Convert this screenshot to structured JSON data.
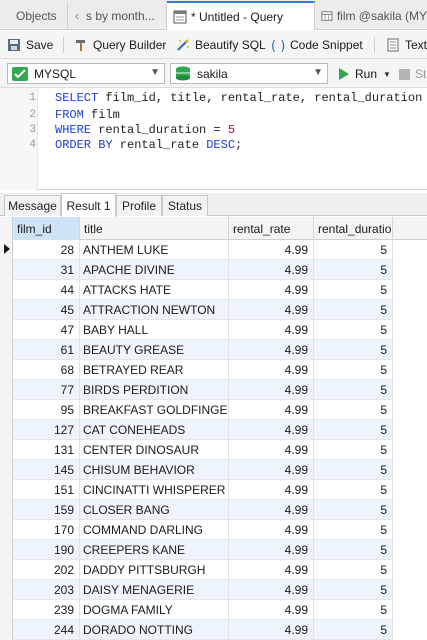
{
  "tabs": [
    {
      "label": "Objects"
    },
    {
      "label": "s by month..."
    },
    {
      "label": "* Untitled - Query"
    },
    {
      "label": "film @sakila (MY"
    }
  ],
  "toolbar": {
    "save": "Save",
    "query_builder": "Query Builder",
    "beautify": "Beautify SQL",
    "snippet": "Code Snippet",
    "text": "Text"
  },
  "connection": {
    "server": "MYSQL",
    "database": "sakila",
    "run": "Run",
    "stop": "St"
  },
  "editor": {
    "lines": [
      {
        "n": "1",
        "parts": [
          [
            "kw",
            "SELECT"
          ],
          [
            "t",
            " film_id, title, rental_rate, rental_duration"
          ]
        ]
      },
      {
        "n": "2",
        "parts": [
          [
            "kw",
            "FROM"
          ],
          [
            "t",
            " film"
          ]
        ]
      },
      {
        "n": "3",
        "parts": [
          [
            "kw",
            "WHERE"
          ],
          [
            "t",
            " rental_duration = "
          ],
          [
            "num",
            "5"
          ]
        ]
      },
      {
        "n": "4",
        "parts": [
          [
            "kw",
            "ORDER BY"
          ],
          [
            "t",
            " rental_rate "
          ],
          [
            "kw",
            "DESC"
          ],
          [
            "t",
            ";"
          ]
        ]
      }
    ]
  },
  "result_tabs": [
    "Message",
    "Result 1",
    "Profile",
    "Status"
  ],
  "grid": {
    "columns": [
      "film_id",
      "title",
      "rental_rate",
      "rental_duratio"
    ],
    "rows": [
      [
        "28",
        "ANTHEM LUKE",
        "4.99",
        "5"
      ],
      [
        "31",
        "APACHE DIVINE",
        "4.99",
        "5"
      ],
      [
        "44",
        "ATTACKS HATE",
        "4.99",
        "5"
      ],
      [
        "45",
        "ATTRACTION NEWTON",
        "4.99",
        "5"
      ],
      [
        "47",
        "BABY HALL",
        "4.99",
        "5"
      ],
      [
        "61",
        "BEAUTY GREASE",
        "4.99",
        "5"
      ],
      [
        "68",
        "BETRAYED REAR",
        "4.99",
        "5"
      ],
      [
        "77",
        "BIRDS PERDITION",
        "4.99",
        "5"
      ],
      [
        "95",
        "BREAKFAST GOLDFINGER",
        "4.99",
        "5"
      ],
      [
        "127",
        "CAT CONEHEADS",
        "4.99",
        "5"
      ],
      [
        "131",
        "CENTER DINOSAUR",
        "4.99",
        "5"
      ],
      [
        "145",
        "CHISUM BEHAVIOR",
        "4.99",
        "5"
      ],
      [
        "151",
        "CINCINATTI WHISPERER",
        "4.99",
        "5"
      ],
      [
        "159",
        "CLOSER BANG",
        "4.99",
        "5"
      ],
      [
        "170",
        "COMMAND DARLING",
        "4.99",
        "5"
      ],
      [
        "190",
        "CREEPERS KANE",
        "4.99",
        "5"
      ],
      [
        "202",
        "DADDY PITTSBURGH",
        "4.99",
        "5"
      ],
      [
        "203",
        "DAISY MENAGERIE",
        "4.99",
        "5"
      ],
      [
        "239",
        "DOGMA FAMILY",
        "4.99",
        "5"
      ],
      [
        "244",
        "DORADO NOTTING",
        "4.99",
        "5"
      ]
    ]
  },
  "colors": {
    "accent": "#3a7bd5",
    "keyword": "#1f3fd1",
    "number": "#c8102e",
    "alt_row": "#eef4fb",
    "selected_header": "#cfe3f7",
    "run_green": "#2fa84f"
  }
}
